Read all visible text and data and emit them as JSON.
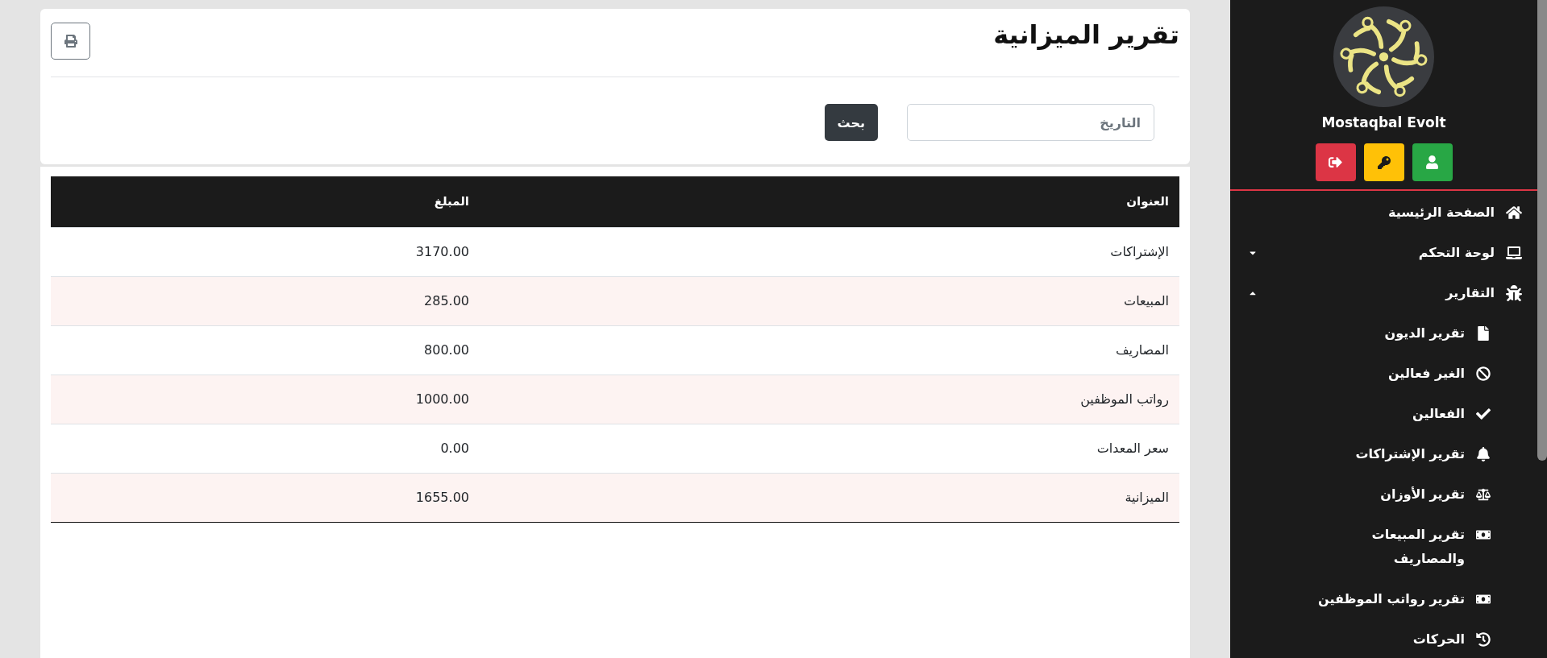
{
  "sidebar": {
    "brand": "Mostaqbal Evolt",
    "action_buttons": [
      {
        "kind": "profile"
      },
      {
        "kind": "password"
      },
      {
        "kind": "logout"
      }
    ],
    "menu": [
      {
        "kind": "link",
        "label": "الصفحة الرئيسية"
      },
      {
        "kind": "group",
        "label": "لوحة التحكم",
        "expanded": false
      },
      {
        "kind": "group",
        "label": "التقارير",
        "expanded": true,
        "children": [
          {
            "label": "تقرير الديون"
          },
          {
            "label": "الغير فعالين"
          },
          {
            "label": "الفعالين"
          },
          {
            "label": "تقرير الإشتراكات"
          },
          {
            "label": "تقرير الأوزان"
          },
          {
            "label": "تقرير المبيعات والمصاريف"
          },
          {
            "label": "تقرير رواتب الموظفين"
          },
          {
            "label": "الحركات"
          }
        ]
      }
    ]
  },
  "header": {
    "title": "تقرير الميزانية",
    "date_field": {
      "placeholder": "التاريخ"
    },
    "search_button": "بحث"
  },
  "table": {
    "columns": [
      "العنوان",
      "المبلغ"
    ],
    "rows": [
      [
        "الإشتراكات",
        "3170.00"
      ],
      [
        "المبيعات",
        "285.00"
      ],
      [
        "المصاريف",
        "800.00"
      ],
      [
        "رواتب الموظفين",
        "1000.00"
      ],
      [
        "سعر المعدات",
        "0.00"
      ],
      [
        "الميزانية",
        "1655.00"
      ]
    ]
  }
}
